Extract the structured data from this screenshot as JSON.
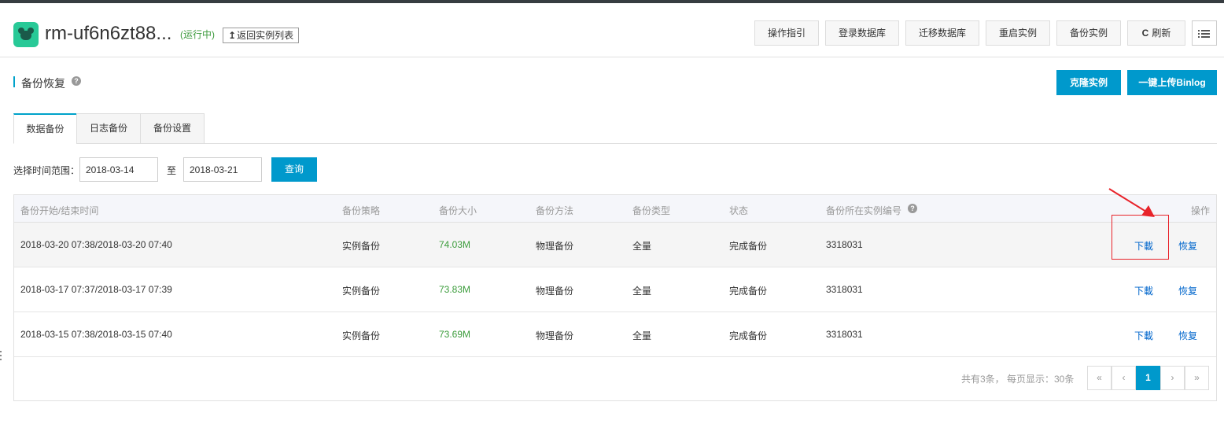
{
  "header": {
    "instance_title": "rm-uf6n6zt88...",
    "run_status": "(运行中)",
    "back_button": "返回实例列表",
    "back_icon": "↥",
    "buttons": [
      "操作指引",
      "登录数据库",
      "迁移数据库",
      "重启实例",
      "备份实例"
    ],
    "refresh_label": "刷新",
    "refresh_icon": "C"
  },
  "section": {
    "title": "备份恢复",
    "help": "?",
    "clone_button": "克隆实例",
    "upload_button": "一键上传Binlog"
  },
  "tabs": [
    {
      "label": "数据备份",
      "active": true
    },
    {
      "label": "日志备份",
      "active": false
    },
    {
      "label": "备份设置",
      "active": false
    }
  ],
  "filter": {
    "label": "选择时间范围：",
    "start": "2018-03-14",
    "separator": "至",
    "end": "2018-03-21",
    "query_button": "查询"
  },
  "table": {
    "columns": [
      "备份开始/结束时间",
      "备份策略",
      "备份大小",
      "备份方法",
      "备份类型",
      "状态",
      "备份所在实例编号",
      "操作"
    ],
    "rows": [
      {
        "time": "2018-03-20 07:38/2018-03-20 07:40",
        "policy": "实例备份",
        "size": "74.03M",
        "method": "物理备份",
        "type": "全量",
        "status": "完成备份",
        "instance_no": "3318031",
        "download": "下載",
        "restore": "恢复"
      },
      {
        "time": "2018-03-17 07:37/2018-03-17 07:39",
        "policy": "实例备份",
        "size": "73.83M",
        "method": "物理备份",
        "type": "全量",
        "status": "完成备份",
        "instance_no": "3318031",
        "download": "下載",
        "restore": "恢复"
      },
      {
        "time": "2018-03-15 07:38/2018-03-15 07:40",
        "policy": "实例备份",
        "size": "73.69M",
        "method": "物理备份",
        "type": "全量",
        "status": "完成备份",
        "instance_no": "3318031",
        "download": "下載",
        "restore": "恢复"
      }
    ]
  },
  "pagination": {
    "info": "共有3条， 每页显示：30条",
    "first": "«",
    "prev": "‹",
    "current": "1",
    "next": "›",
    "last": "»"
  },
  "colors": {
    "accent": "#0099cc",
    "running": "#3c9a3c",
    "annotation": "#e8232a"
  }
}
